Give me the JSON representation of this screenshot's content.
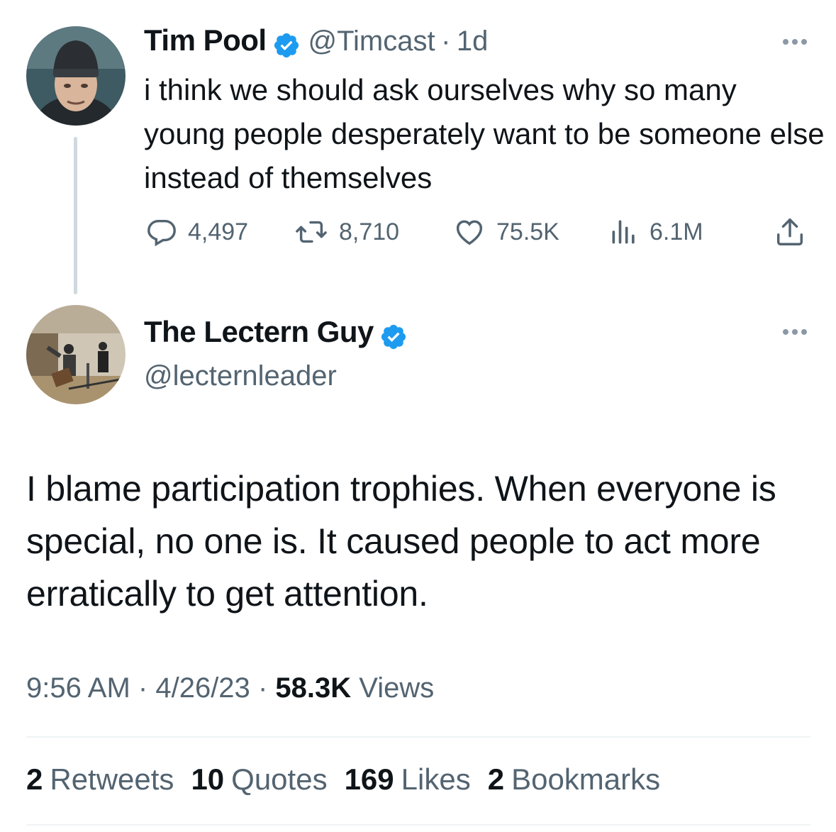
{
  "original_tweet": {
    "author_name": "Tim Pool",
    "handle": "@Timcast",
    "separator": "·",
    "age": "1d",
    "text": "i think we should ask ourselves why so many young people desperately want to be someone else instead of themselves",
    "actions": {
      "replies": "4,497",
      "retweets": "8,710",
      "likes": "75.5K",
      "views": "6.1M"
    }
  },
  "reply_tweet": {
    "author_name": "The Lectern Guy",
    "handle": "@lecternleader",
    "text": "I blame participation trophies. When everyone is special, no one is. It caused people to act more erratically to get attention.",
    "time": "9:56 AM",
    "date": "4/26/23",
    "separator": "·",
    "views_count": "58.3K",
    "views_label": "Views",
    "stats": {
      "retweets_count": "2",
      "retweets_label": "Retweets",
      "quotes_count": "10",
      "quotes_label": "Quotes",
      "likes_count": "169",
      "likes_label": "Likes",
      "bookmarks_count": "2",
      "bookmarks_label": "Bookmarks"
    }
  },
  "colors": {
    "verified_blue": "#1d9bf0",
    "secondary_text": "#536471",
    "primary_text": "#0f1419",
    "thread_line": "#cfd9de"
  },
  "icons": [
    "verified-badge-icon",
    "more-icon",
    "reply-icon",
    "retweet-icon",
    "like-icon",
    "views-icon",
    "share-icon"
  ]
}
